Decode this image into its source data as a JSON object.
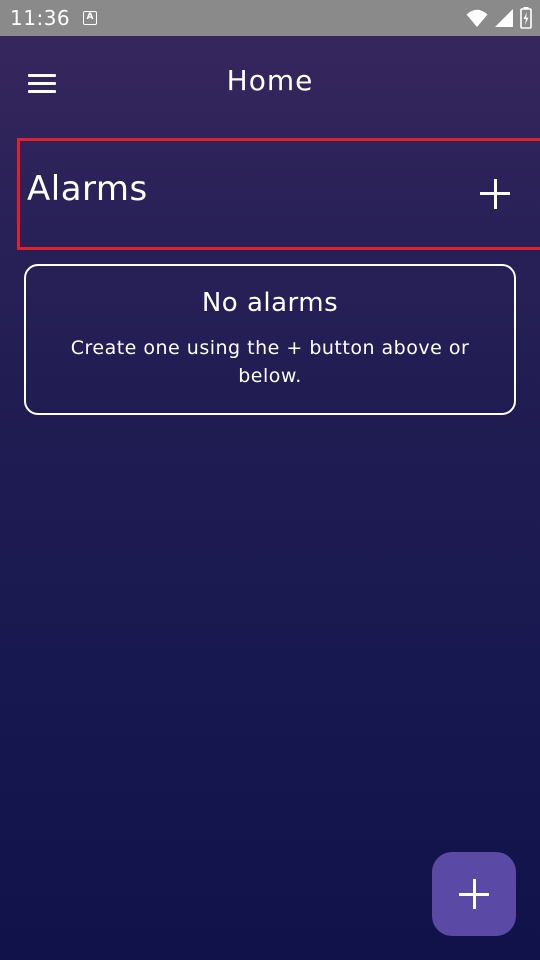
{
  "status_bar": {
    "time": "11:36",
    "notification_icon_letter": "A",
    "icons": [
      "wifi-icon",
      "signal-icon",
      "battery-charging-icon"
    ]
  },
  "app_bar": {
    "title": "Home",
    "menu_icon": "hamburger-menu-icon"
  },
  "section": {
    "title": "Alarms",
    "add_icon": "plus-icon"
  },
  "empty_state": {
    "title": "No alarms",
    "description": "Create one using the + button above or below."
  },
  "fab": {
    "icon": "plus-icon",
    "color": "#5a4aa6"
  },
  "colors": {
    "highlight_border": "#e0202c",
    "status_bar": "#8a8a8a",
    "background_top": "#3a2860",
    "background_bottom": "#11124a"
  }
}
